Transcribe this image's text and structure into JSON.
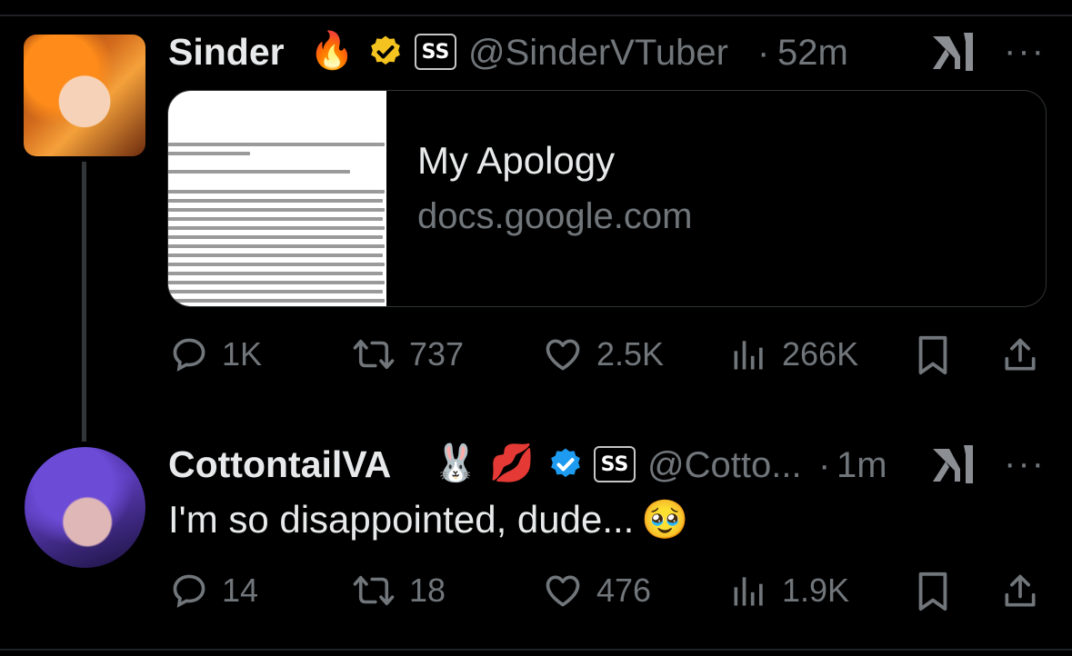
{
  "tweet1": {
    "display_name": "Sinder",
    "name_emoji": "🔥",
    "handle": "@SinderVTuber",
    "separator": "·",
    "time": "52m",
    "affiliate_badge": "SS",
    "card": {
      "title": "My Apology",
      "domain": "docs.google.com"
    },
    "actions": {
      "replies": "1K",
      "retweets": "737",
      "likes": "2.5K",
      "views": "266K"
    }
  },
  "tweet2": {
    "display_name": "CottontailVA",
    "name_emoji_1": "🐰",
    "name_emoji_2": "💋",
    "handle": "@Cotto...",
    "separator": "·",
    "time": "1m",
    "affiliate_badge": "SS",
    "text": "I'm so disappointed, dude...",
    "text_emoji": "🥹",
    "actions": {
      "replies": "14",
      "retweets": "18",
      "likes": "476",
      "views": "1.9K"
    }
  },
  "colors": {
    "background": "#000000",
    "primary_text": "#e7e9ea",
    "secondary_text": "#71767b",
    "gold_verified": "#f4c31f",
    "blue_verified": "#1d9bf0"
  },
  "icons": [
    "reply-icon",
    "retweet-icon",
    "like-icon",
    "views-icon",
    "bookmark-icon",
    "share-icon",
    "grok-icon",
    "more-icon",
    "verified-badge-icon"
  ]
}
